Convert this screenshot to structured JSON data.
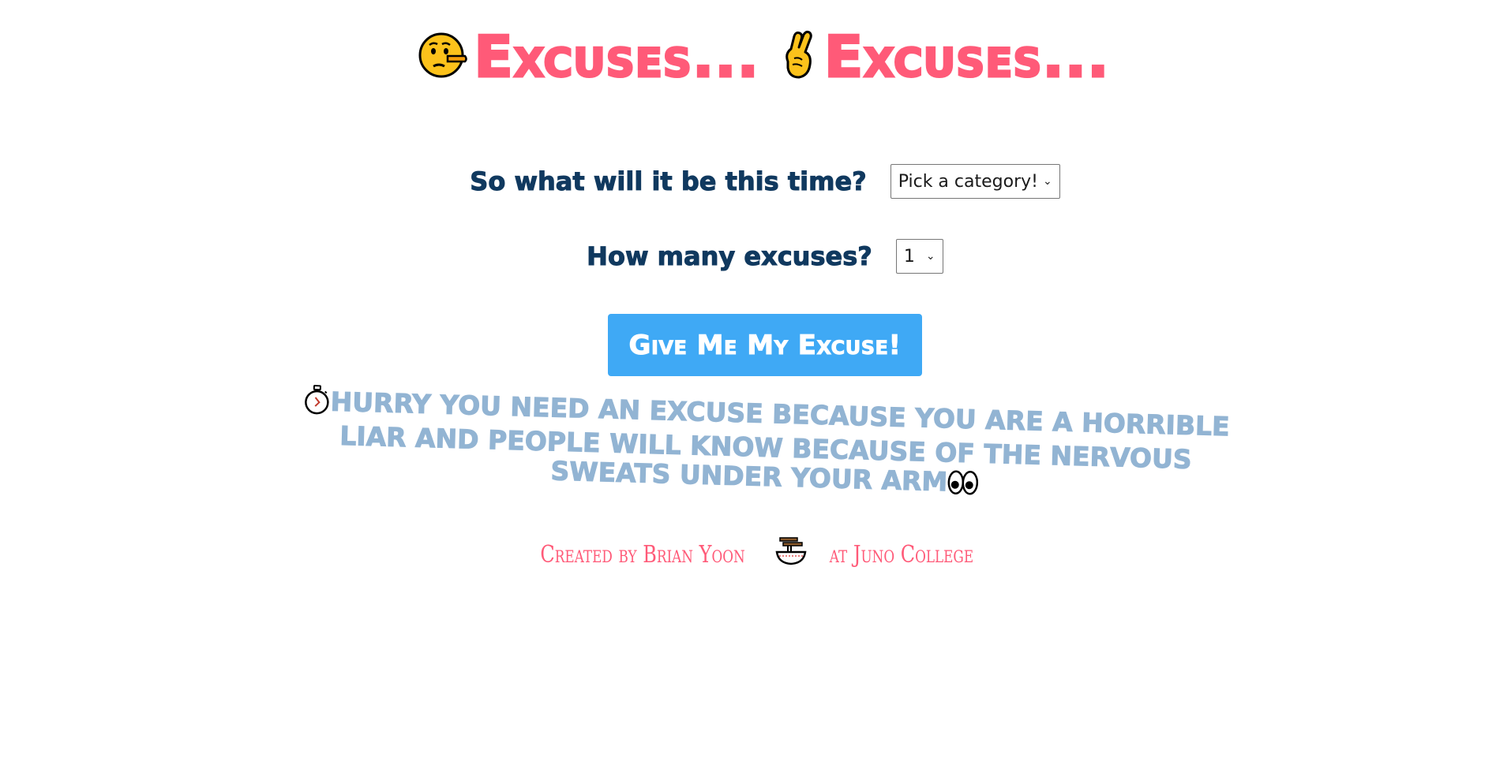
{
  "header": {
    "title_left": "Excuses...",
    "title_right": "Excuses...",
    "icon_left": "lying-face-icon",
    "icon_right": "crossed-fingers-icon"
  },
  "form": {
    "category_label": "So what will it be this time?",
    "category_selected": "Pick a category!",
    "count_label": "How many excuses?",
    "count_selected": "1"
  },
  "button": {
    "label": "Give Me My Excuse!"
  },
  "result": {
    "text": "Hurry you need an excuse because you are a horrible liar and people will know because of the nervous sweats under your arm",
    "icon_before": "stopwatch-icon",
    "icon_after": "eyes-icon"
  },
  "footer": {
    "prefix": "Created by Brian Yoon",
    "suffix": "at Juno College",
    "icon": "noodle-bowl-icon"
  },
  "colors": {
    "title": "#ff5a78",
    "label": "#10395f",
    "button": "#3fa9f5",
    "result": "#92b4d3",
    "footer": "#ff5a78"
  }
}
